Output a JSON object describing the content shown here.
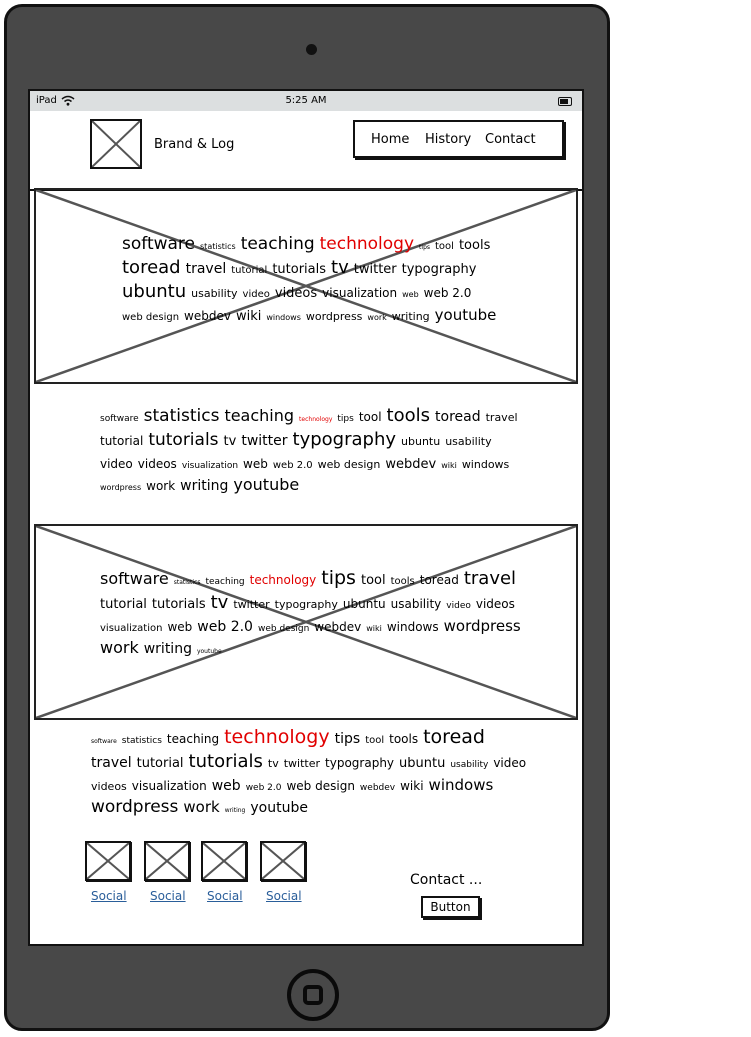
{
  "status_bar": {
    "carrier": "iPad",
    "time": "5:25 AM"
  },
  "header": {
    "brand": "Brand & Log",
    "nav": [
      "Home",
      "History",
      "Contact"
    ]
  },
  "clouds": [
    [
      [
        [
          "software",
          17,
          0
        ],
        [
          "statistics",
          8,
          0
        ],
        [
          "teaching",
          17,
          0
        ],
        [
          "technology",
          17,
          1
        ],
        [
          "tips",
          6,
          0
        ],
        [
          "tool",
          10,
          0
        ],
        [
          "tools",
          13,
          0
        ]
      ],
      [
        [
          "toread",
          18,
          0
        ],
        [
          "travel",
          14,
          0
        ],
        [
          "tutorial",
          10,
          0
        ],
        [
          "tutorials",
          13,
          0
        ],
        [
          "tv",
          18,
          0
        ],
        [
          "twitter",
          13,
          0
        ],
        [
          "typography",
          13,
          0
        ]
      ],
      [
        [
          "ubuntu",
          18,
          0
        ],
        [
          "usability",
          11,
          0
        ],
        [
          "video",
          10,
          0
        ],
        [
          "videos",
          13,
          0
        ],
        [
          "visualization",
          12,
          0
        ],
        [
          "web",
          8,
          0
        ],
        [
          "web 2.0",
          12,
          0
        ]
      ],
      [
        [
          "web design",
          10,
          0
        ],
        [
          "webdev",
          12,
          0
        ],
        [
          "wiki",
          13,
          0
        ],
        [
          "windows",
          8,
          0
        ],
        [
          "wordpress",
          11,
          0
        ],
        [
          "work",
          8,
          0
        ],
        [
          "writing",
          11,
          0
        ],
        [
          "youtube",
          15,
          0
        ]
      ]
    ],
    [
      [
        [
          "software",
          9,
          0
        ],
        [
          "statistics",
          17,
          0
        ],
        [
          "teaching",
          16,
          0
        ],
        [
          "technology",
          6,
          1
        ],
        [
          "tips",
          9,
          0
        ],
        [
          "tool",
          12,
          0
        ],
        [
          "tools",
          18,
          0
        ],
        [
          "toread",
          14,
          0
        ],
        [
          "travel",
          11,
          0
        ]
      ],
      [
        [
          "tutorial",
          12,
          0
        ],
        [
          "tutorials",
          17,
          0
        ],
        [
          "tv",
          13,
          0
        ],
        [
          "twitter",
          14,
          0
        ],
        [
          "typography",
          18,
          0
        ],
        [
          "ubuntu",
          11,
          0
        ],
        [
          "usability",
          11,
          0
        ]
      ],
      [
        [
          "video",
          12,
          0
        ],
        [
          "videos",
          12,
          0
        ],
        [
          "visualization",
          9,
          0
        ],
        [
          "web",
          12,
          0
        ],
        [
          "web 2.0",
          10,
          0
        ],
        [
          "web design",
          11,
          0
        ],
        [
          "webdev",
          13,
          0
        ],
        [
          "wiki",
          8,
          0
        ],
        [
          "windows",
          11,
          0
        ]
      ],
      [
        [
          "wordpress",
          8,
          0
        ],
        [
          "work",
          12,
          0
        ],
        [
          "writing",
          14,
          0
        ],
        [
          "youtube",
          16,
          0
        ]
      ]
    ],
    [
      [
        [
          "software",
          16,
          0
        ],
        [
          "statistics",
          6,
          0
        ],
        [
          "teaching",
          9,
          0
        ],
        [
          "technology",
          12,
          1
        ],
        [
          "tips",
          19,
          0
        ],
        [
          "tool",
          13,
          0
        ],
        [
          "tools",
          10,
          0
        ],
        [
          "toread",
          12,
          0
        ],
        [
          "travel",
          18,
          0
        ]
      ],
      [
        [
          "tutorial",
          13,
          0
        ],
        [
          "tutorials",
          13,
          0
        ],
        [
          "tv",
          18,
          0
        ],
        [
          "twitter",
          11,
          0
        ],
        [
          "typography",
          11,
          0
        ],
        [
          "ubuntu",
          12,
          0
        ],
        [
          "usability",
          12,
          0
        ],
        [
          "video",
          9,
          0
        ],
        [
          "videos",
          12,
          0
        ]
      ],
      [
        [
          "visualization",
          10,
          0
        ],
        [
          "web",
          12,
          0
        ],
        [
          "web 2.0",
          14,
          0
        ],
        [
          "web design",
          9,
          0
        ],
        [
          "webdev",
          12,
          0
        ],
        [
          "wiki",
          8,
          0
        ],
        [
          "windows",
          12,
          0
        ],
        [
          "wordpress",
          15,
          0
        ]
      ],
      [
        [
          "work",
          16,
          0
        ],
        [
          "writing",
          14,
          0
        ],
        [
          "youtube",
          6,
          0
        ]
      ]
    ],
    [
      [
        [
          "software",
          6,
          0
        ],
        [
          "statistics",
          9,
          0
        ],
        [
          "teaching",
          12,
          0
        ],
        [
          "technology",
          19,
          1
        ],
        [
          "tips",
          14,
          0
        ],
        [
          "tool",
          10,
          0
        ],
        [
          "tools",
          12,
          0
        ],
        [
          "toread",
          19,
          0
        ]
      ],
      [
        [
          "travel",
          14,
          0
        ],
        [
          "tutorial",
          13,
          0
        ],
        [
          "tutorials",
          18,
          0
        ],
        [
          "tv",
          11,
          0
        ],
        [
          "twitter",
          11,
          0
        ],
        [
          "typography",
          12,
          0
        ],
        [
          "ubuntu",
          13,
          0
        ],
        [
          "usability",
          9,
          0
        ],
        [
          "video",
          12,
          0
        ]
      ],
      [
        [
          "videos",
          11,
          0
        ],
        [
          "visualization",
          12,
          0
        ],
        [
          "web",
          14,
          0
        ],
        [
          "web 2.0",
          9,
          0
        ],
        [
          "web design",
          12,
          0
        ],
        [
          "webdev",
          9,
          0
        ],
        [
          "wiki",
          12,
          0
        ],
        [
          "windows",
          15,
          0
        ]
      ],
      [
        [
          "wordpress",
          17,
          0
        ],
        [
          "work",
          15,
          0
        ],
        [
          "writing",
          6,
          0
        ],
        [
          "youtube",
          14,
          0
        ]
      ]
    ]
  ],
  "footer": {
    "social_links": [
      "Social",
      "Social",
      "Social",
      "Social"
    ],
    "contact_label": "Contact ...",
    "button_label": "Button"
  },
  "colors": {
    "device": "#484848",
    "highlight": "#e10000",
    "link": "#2a5e9a",
    "statusbar": "#dcdfe0"
  },
  "icons": [
    "wifi-icon",
    "battery-icon",
    "image-placeholder-icon",
    "home-button-icon"
  ]
}
